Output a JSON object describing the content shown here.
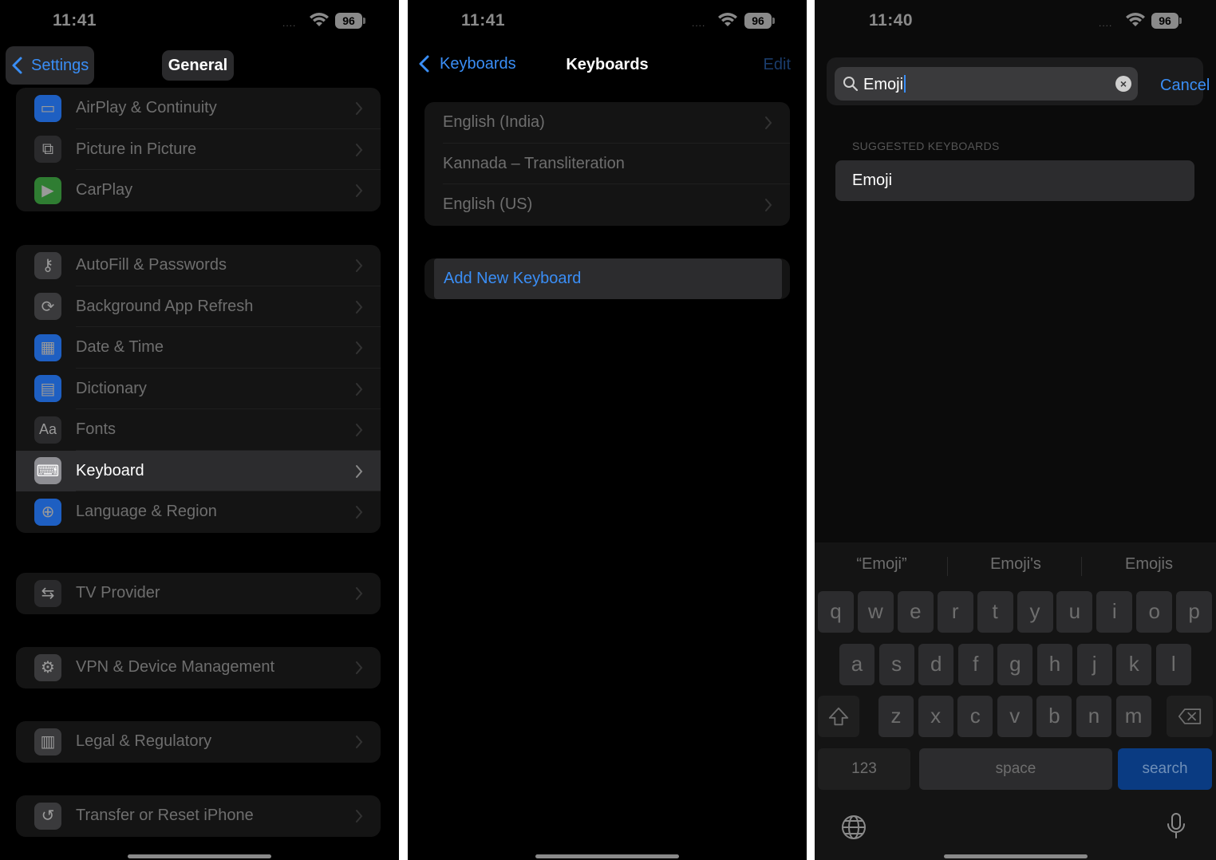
{
  "panel1": {
    "status": {
      "time": "11:41",
      "signal": "....",
      "battery": "96"
    },
    "nav": {
      "back_label": "Settings",
      "title": "General"
    },
    "groups": [
      [
        {
          "label": "AirPlay & Continuity",
          "icon": "airplay-icon",
          "color": "#1e5fc2"
        },
        {
          "label": "Picture in Picture",
          "icon": "picture-in-picture-icon",
          "color": "#2a2a2c"
        },
        {
          "label": "CarPlay",
          "icon": "carplay-icon",
          "color": "#2f7d32"
        }
      ],
      [
        {
          "label": "AutoFill & Passwords",
          "icon": "key-icon",
          "color": "#3a3a3c"
        },
        {
          "label": "Background App Refresh",
          "icon": "refresh-icon",
          "color": "#3a3a3c"
        },
        {
          "label": "Date & Time",
          "icon": "calendar-icon",
          "color": "#1e5fc2"
        },
        {
          "label": "Dictionary",
          "icon": "book-icon",
          "color": "#1e5fc2"
        },
        {
          "label": "Fonts",
          "icon": "fonts-icon",
          "color": "#2a2a2c"
        },
        {
          "label": "Keyboard",
          "icon": "keyboard-icon",
          "color": "#8e8e93",
          "active": true
        },
        {
          "label": "Language & Region",
          "icon": "globe-icon",
          "color": "#1e5fc2"
        }
      ],
      [
        {
          "label": "TV Provider",
          "icon": "tv-provider-icon",
          "color": "#2a2a2c"
        }
      ],
      [
        {
          "label": "VPN & Device Management",
          "icon": "gear-icon",
          "color": "#3a3a3c"
        }
      ],
      [
        {
          "label": "Legal & Regulatory",
          "icon": "legal-icon",
          "color": "#3a3a3c"
        }
      ],
      [
        {
          "label": "Transfer or Reset iPhone",
          "icon": "reset-icon",
          "color": "#3a3a3c"
        }
      ]
    ]
  },
  "panel2": {
    "status": {
      "time": "11:41",
      "signal": "....",
      "battery": "96"
    },
    "nav": {
      "back_label": "Keyboards",
      "title": "Keyboards",
      "edit_label": "Edit"
    },
    "keyboards": [
      {
        "label": "English (India)",
        "chevron": true
      },
      {
        "label": "Kannada – Transliteration",
        "chevron": false
      },
      {
        "label": "English (US)",
        "chevron": true
      }
    ],
    "add_label": "Add New Keyboard"
  },
  "panel3": {
    "status": {
      "time": "11:40",
      "signal": "....",
      "battery": "96"
    },
    "search": {
      "value": "Emoji",
      "cancel_label": "Cancel"
    },
    "section_header": "SUGGESTED KEYBOARDS",
    "suggestion": "Emoji",
    "predictions": [
      "“Emoji”",
      "Emoji's",
      "Emojis"
    ],
    "rows": {
      "row1": [
        "q",
        "w",
        "e",
        "r",
        "t",
        "y",
        "u",
        "i",
        "o",
        "p"
      ],
      "row2": [
        "a",
        "s",
        "d",
        "f",
        "g",
        "h",
        "j",
        "k",
        "l"
      ],
      "row3": [
        "z",
        "x",
        "c",
        "v",
        "b",
        "n",
        "m"
      ]
    },
    "keys": {
      "numbers": "123",
      "space": "space",
      "search": "search"
    }
  }
}
